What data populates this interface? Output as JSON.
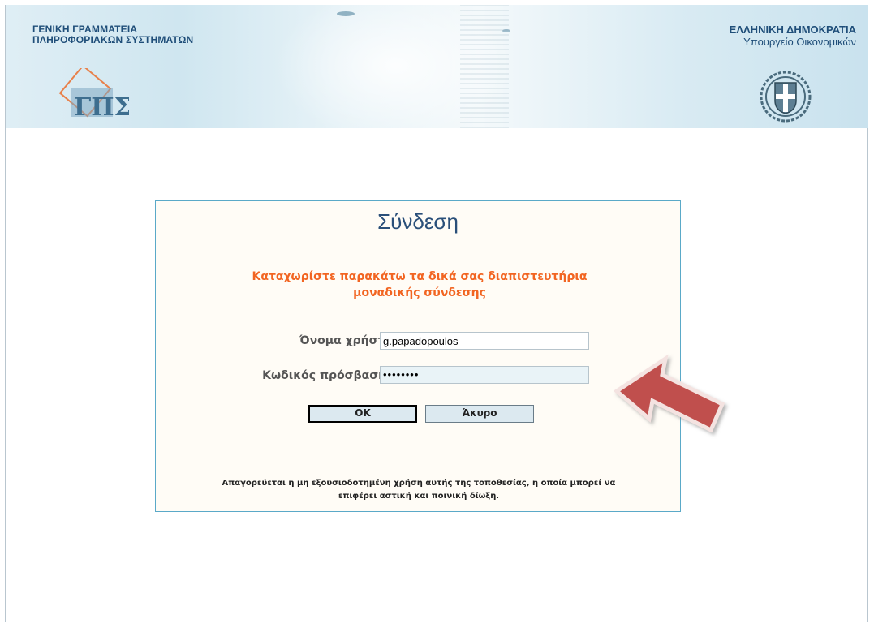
{
  "header": {
    "org_line1": "ΓΕΝΙΚΗ ΓΡΑΜΜΑΤΕΙΑ",
    "org_line2": "ΠΛΗΡΟΦΟΡΙΑΚΩΝ ΣΥΣΤΗΜΑΤΩΝ",
    "gov_line1": "ΕΛΛΗΝΙΚΗ ΔΗΜΟΚΡΑΤΙΑ",
    "gov_line2": "Υπουργείο Οικονομικών",
    "logo_text": "ΓΠΣ"
  },
  "login": {
    "title": "Σύνδεση",
    "instructions_line1": "Καταχωρίστε παρακάτω τα δικά σας διαπιστευτήρια",
    "instructions_line2": "μοναδικής σύνδεσης",
    "username_label": "Όνομα χρήστη:",
    "username_value": "g.papadopoulos",
    "password_label": "Κωδικός πρόσβασης:",
    "password_value": "••••••••",
    "ok_label": "OK",
    "cancel_label": "Άκυρο",
    "disclaimer_line1": "Απαγορεύεται η μη εξουσιοδοτημένη χρήση αυτής της τοποθεσίας, η οποία μπορεί να",
    "disclaimer_line2": "επιφέρει αστική και ποινική δίωξη."
  },
  "colors": {
    "accent_orange": "#f26522",
    "title_blue": "#2a4f79",
    "box_border": "#5aa9c8",
    "arrow_red": "#c0504d"
  }
}
